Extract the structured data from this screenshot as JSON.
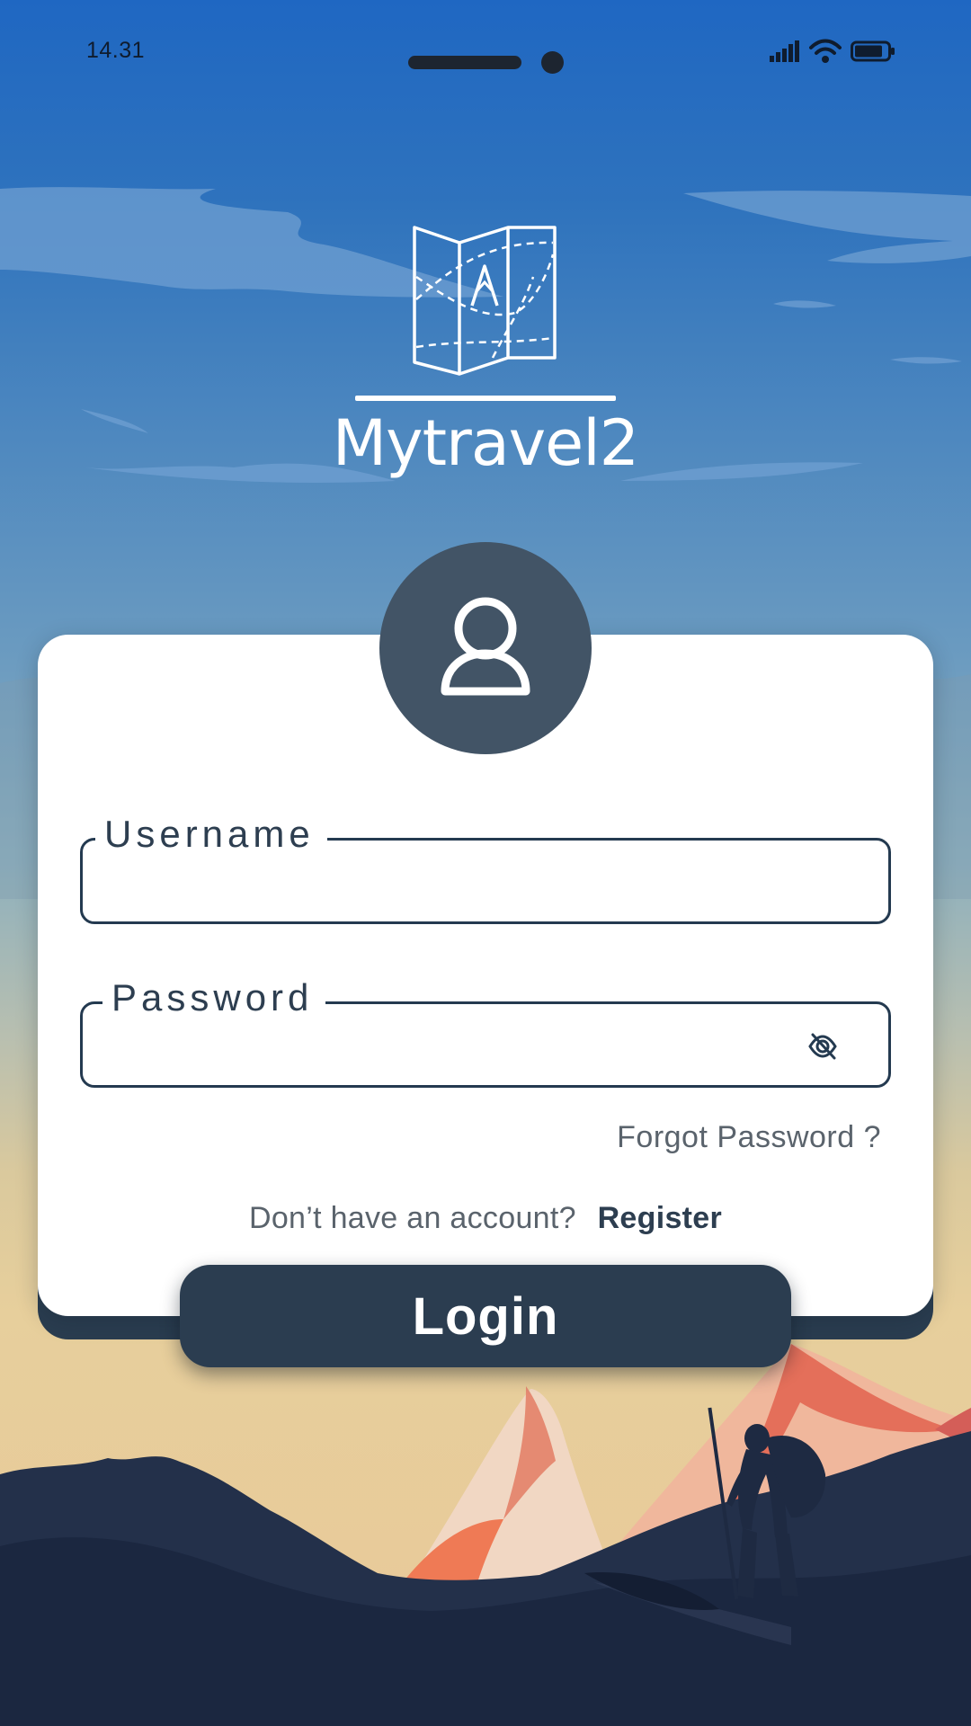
{
  "status_bar": {
    "time": "14.31",
    "icons": [
      "signal-icon",
      "wifi-icon",
      "battery-icon"
    ]
  },
  "app": {
    "name": "Mytravel2",
    "logo_icon": "folded-map-icon"
  },
  "login_form": {
    "avatar_icon": "user-icon",
    "username": {
      "label": "Username",
      "value": ""
    },
    "password": {
      "label": "Password",
      "value": "",
      "toggle_icon": "eye-slash-icon"
    },
    "forgot_password": "Forgot Password ?",
    "register_prompt": "Don’t have an account?",
    "register_link": "Register",
    "login_button": "Login"
  },
  "colors": {
    "primary_dark": "#2b3d50",
    "avatar": "#425466",
    "text_muted": "#5a636c",
    "sky_top": "#1f67c2",
    "sky_bottom": "#e8c898"
  }
}
